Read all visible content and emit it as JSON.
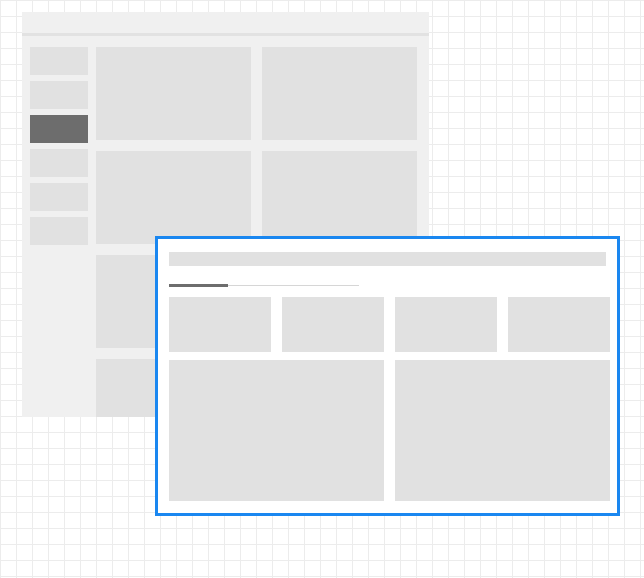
{
  "background_window": {
    "sidebar": {
      "item_count": 6,
      "active_index": 2
    },
    "card_count": 8
  },
  "foreground_window": {
    "selected": true,
    "tab_count": 1,
    "stat_tile_count": 4,
    "panel_count": 2
  },
  "colors": {
    "selection_border": "#1a87f0",
    "placeholder": "#e1e1e1",
    "active_item": "#6d6d6d",
    "window_bg": "#f0f0f0"
  }
}
